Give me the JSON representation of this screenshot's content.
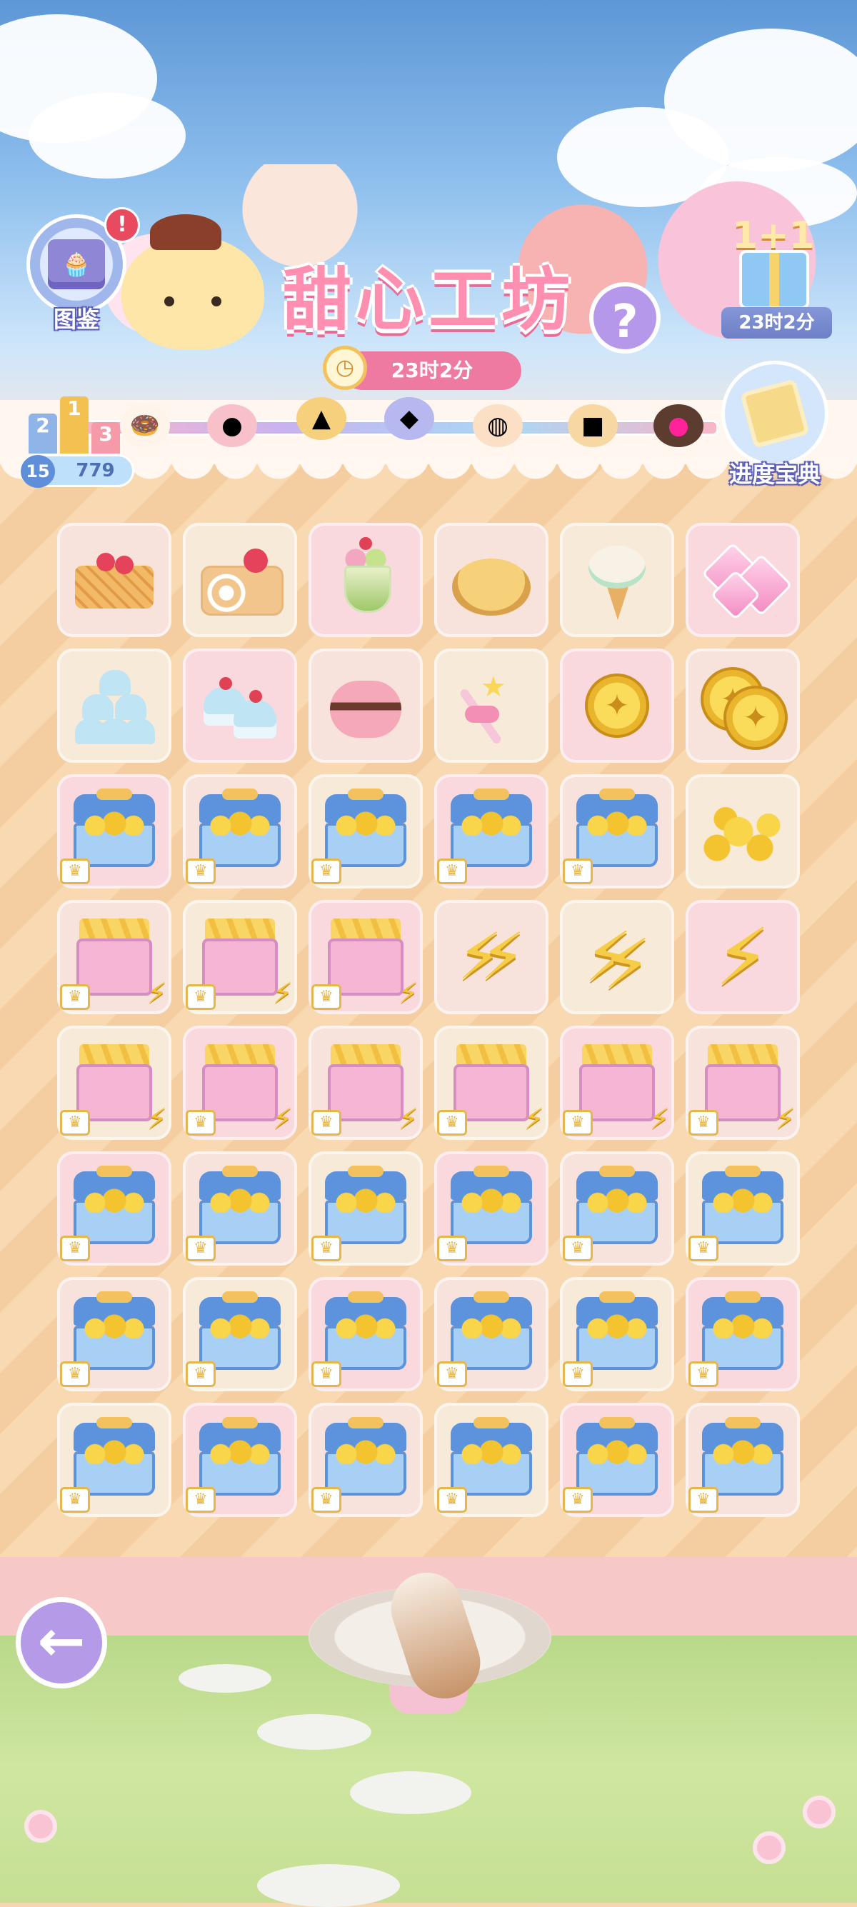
{
  "header": {
    "title": "甜心工坊",
    "codex_label": "图鉴",
    "codex_alert": "!",
    "help_symbol": "?",
    "event_timer": "23时2分",
    "gift_promo": "1+1",
    "gift_timer": "23时2分",
    "guide_label": "进度宝典"
  },
  "progress": {
    "level": "15",
    "points": "779",
    "podium": [
      "2",
      "1",
      "3"
    ]
  },
  "board": {
    "rows": [
      [
        "waffle",
        "roll-cake",
        "parfait",
        "cream-puff",
        "ice-cream",
        "gems"
      ],
      [
        "cupcake-tower",
        "cupcakes",
        "macaron",
        "star-wand",
        "coin",
        "coins"
      ],
      [
        "chest",
        "chest",
        "chest",
        "chest",
        "chest",
        "coin-pile"
      ],
      [
        "energy-bag",
        "energy-bag",
        "energy-bag",
        "bolt-bundle",
        "double-bolt",
        "bolt"
      ],
      [
        "energy-bag",
        "energy-bag",
        "energy-bag",
        "energy-bag",
        "energy-bag",
        "energy-bag"
      ],
      [
        "chest",
        "chest",
        "chest",
        "chest",
        "chest",
        "chest"
      ],
      [
        "chest",
        "chest",
        "chest",
        "chest",
        "chest",
        "chest"
      ],
      [
        "chest",
        "chest",
        "chest",
        "chest",
        "chest",
        "chest"
      ]
    ]
  },
  "nav": {
    "back_symbol": "←"
  },
  "colors": {
    "accent_pink": "#ef7aa1",
    "accent_purple": "#b59ae8",
    "board_bg": "#f8d9b2"
  }
}
